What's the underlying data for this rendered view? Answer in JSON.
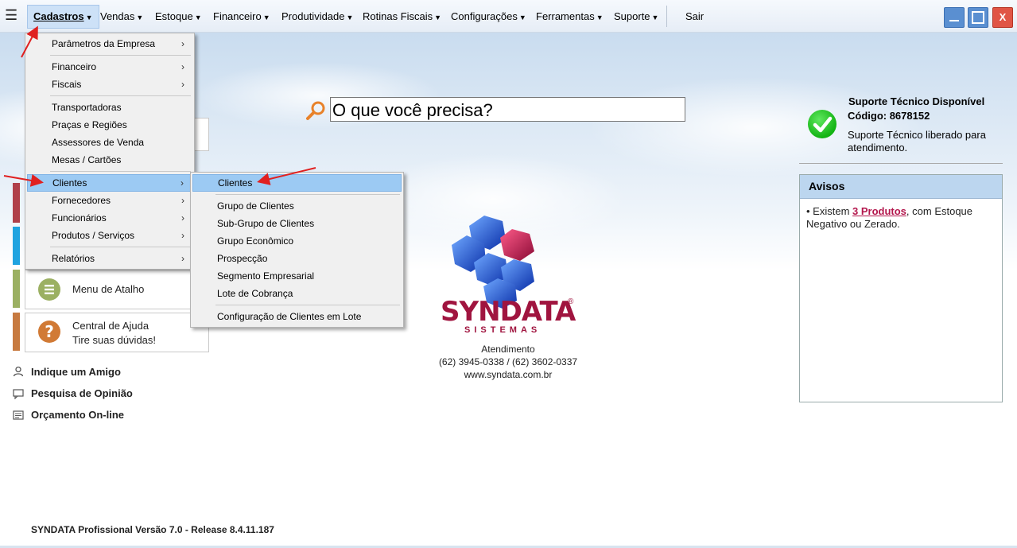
{
  "menubar": {
    "items": [
      {
        "label": "Cadastros"
      },
      {
        "label": "Vendas"
      },
      {
        "label": "Estoque"
      },
      {
        "label": "Financeiro"
      },
      {
        "label": "Produtividade"
      },
      {
        "label": "Rotinas Fiscais"
      },
      {
        "label": "Configurações"
      },
      {
        "label": "Ferramentas"
      },
      {
        "label": "Suporte"
      }
    ],
    "exit": "Sair",
    "close_glyph": "X"
  },
  "cadastros_menu": [
    {
      "label": "Parâmetros da Empresa",
      "submenu": true
    },
    {
      "label": "Financeiro",
      "submenu": true
    },
    {
      "label": "Fiscais",
      "submenu": true
    },
    {
      "label": "Transportadoras",
      "submenu": false
    },
    {
      "label": "Praças e Regiões",
      "submenu": false
    },
    {
      "label": "Assessores de Venda",
      "submenu": false
    },
    {
      "label": "Mesas / Cartões",
      "submenu": false
    },
    {
      "label": "Clientes",
      "submenu": true
    },
    {
      "label": "Fornecedores",
      "submenu": true
    },
    {
      "label": "Funcionários",
      "submenu": true
    },
    {
      "label": "Produtos / Serviços",
      "submenu": true
    },
    {
      "label": "Relatórios",
      "submenu": true
    }
  ],
  "clientes_submenu": [
    {
      "label": "Clientes"
    },
    {
      "label": "Grupo de Clientes"
    },
    {
      "label": "Sub-Grupo de Clientes"
    },
    {
      "label": "Grupo Econômico"
    },
    {
      "label": "Prospecção"
    },
    {
      "label": "Segmento Empresarial"
    },
    {
      "label": "Lote de Cobrança"
    },
    {
      "label": "Configuração de Clientes em Lote"
    }
  ],
  "search": {
    "placeholder": "O que você precisa?"
  },
  "left_panel": {
    "menu_atalho": "Menu de Atalho",
    "central_ajuda_title": "Central de Ajuda",
    "central_ajuda_sub": "Tire suas dúvidas!",
    "links": [
      "Indique um Amigo",
      "Pesquisa de Opinião",
      "Orçamento On-line"
    ],
    "stripe_colors": [
      "#b0404a",
      "#1fa3e0",
      "#9bb062",
      "#c77a40"
    ]
  },
  "support": {
    "title": "Suporte Técnico Disponível",
    "code": "Código: 8678152",
    "description": "Suporte Técnico liberado para atendimento."
  },
  "avisos": {
    "title": "Avisos",
    "prefix": "• Existem ",
    "link": "3 Produtos",
    "suffix": ", com Estoque Negativo ou Zerado."
  },
  "logo": {
    "name": "SYNDATA",
    "sub": "SISTEMAS",
    "reg": "®"
  },
  "contact": {
    "title": "Atendimento",
    "phones": "(62) 3945-0338 / (62) 3602-0337",
    "site": "www.syndata.com.br"
  },
  "footer": {
    "version": "SYNDATA Profissional Versão 7.0 - Release 8.4.11.187"
  }
}
